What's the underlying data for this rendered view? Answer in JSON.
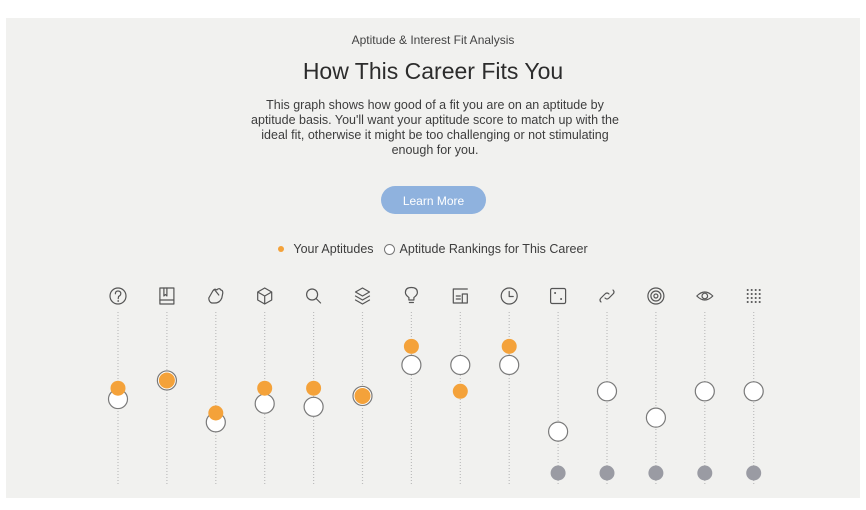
{
  "header": {
    "eyebrow": "Aptitude & Interest Fit Analysis",
    "title": "How This Career Fits You",
    "description": "This graph shows how good of a fit you are on an aptitude by aptitude basis. You'll want your aptitude score to match up with the ideal fit, otherwise it might be too challenging or not stimulating enough for you.",
    "learn_more_label": "Learn More"
  },
  "legend": {
    "your_aptitudes": "Your Aptitudes",
    "career_rankings": "Aptitude Rankings for This Career"
  },
  "colors": {
    "your_aptitude": "#f4a23a",
    "career_ranking_fill": "#ffffff",
    "career_ranking_stroke": "#7a7a7a",
    "not_scored": "#9a9ba3",
    "track": "#bdbdbd",
    "button": "#8fb2de"
  },
  "chart_data": {
    "type": "scatter",
    "title": "",
    "xlabel": "",
    "ylabel": "",
    "ylim": [
      0,
      1
    ],
    "categories": [
      "question-icon",
      "book-icon",
      "hand-icon",
      "cube-icon",
      "magnifier-icon",
      "layers-icon",
      "lightbulb-icon",
      "speaking-icon",
      "clock-icon",
      "square-dot-icon",
      "link-icon",
      "target-icon",
      "eye-icon",
      "grid-icon"
    ],
    "series": [
      {
        "name": "Your Aptitudes",
        "values": [
          0.56,
          0.61,
          0.4,
          0.56,
          0.56,
          0.51,
          0.83,
          0.54,
          0.83,
          null,
          null,
          null,
          null,
          null
        ]
      },
      {
        "name": "Aptitude Rankings for This Career",
        "values": [
          0.49,
          0.61,
          0.34,
          0.46,
          0.44,
          0.51,
          0.71,
          0.71,
          0.71,
          0.28,
          0.54,
          0.37,
          0.54,
          0.54
        ]
      }
    ],
    "not_scored": [
      false,
      false,
      false,
      false,
      false,
      false,
      false,
      false,
      false,
      true,
      true,
      true,
      true,
      true
    ]
  }
}
